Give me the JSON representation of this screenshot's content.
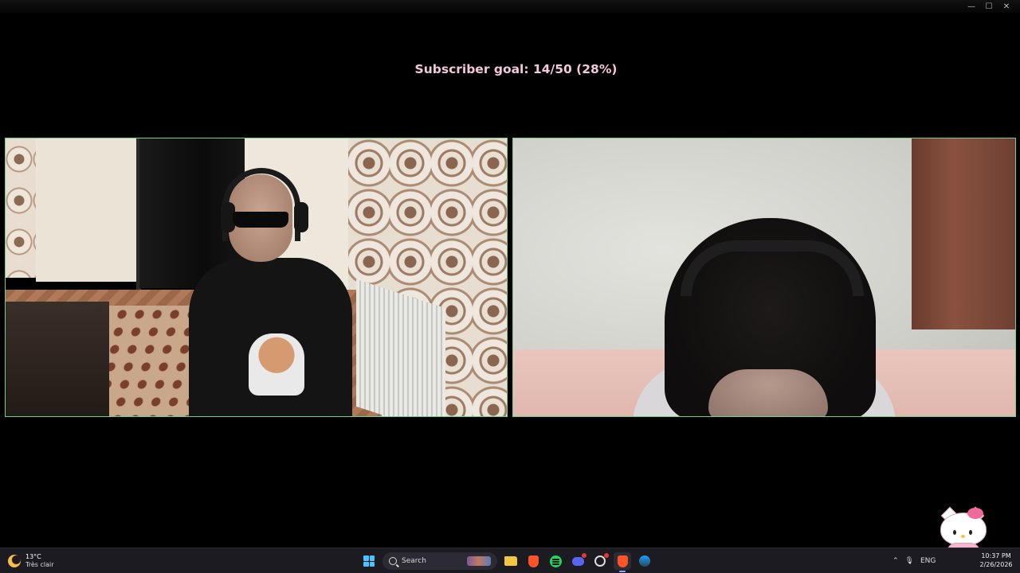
{
  "window": {
    "controls": [
      "—",
      "☐",
      "✕"
    ]
  },
  "overlay": {
    "goal_text": "Subscriber goal: 14/50 (28%)",
    "text_color": "#f1c8d8",
    "border_color": "#6fd08a"
  },
  "taskbar": {
    "weather": {
      "temp": "13°C",
      "desc": "Très clair"
    },
    "search": {
      "placeholder": "Search"
    },
    "tray": {
      "lang": "ENG"
    },
    "clock": {
      "time": "10:37 PM",
      "date": "2/26/2026"
    }
  }
}
